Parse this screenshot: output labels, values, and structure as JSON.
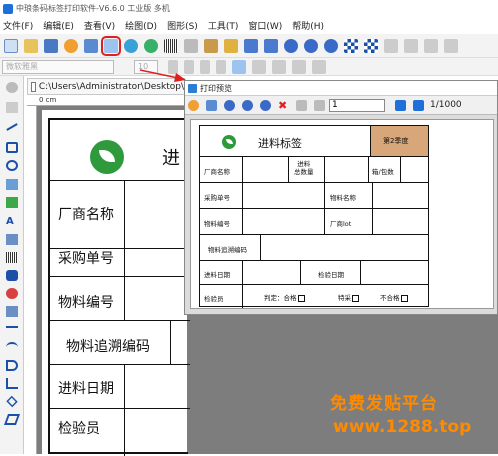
{
  "app": {
    "title": "中琅条码标签打印软件-V6.6.0 工业版 多机"
  },
  "menu": [
    "文件(F)",
    "编辑(E)",
    "查看(V)",
    "绘图(D)",
    "图形(S)",
    "工具(T)",
    "窗口(W)",
    "帮助(H)"
  ],
  "format_bar": {
    "font_placeholder": "微软雅黑",
    "size_placeholder": "10"
  },
  "doc_tab": {
    "path": "C:\\Users\\Administrator\\Desktop\\"
  },
  "ruler": {
    "origin": "0 cm"
  },
  "big_label": {
    "header_char": "进",
    "rows": [
      "厂商名称",
      "采购单号",
      "物料编号",
      "物料追溯编码",
      "进料日期",
      "检验员"
    ]
  },
  "preview": {
    "title": "打印预览",
    "page_value": "1",
    "page_count": "1/1000",
    "label": {
      "title": "进料标签",
      "season": "第2季度",
      "vendor": "厂商名称",
      "qty": "进料\n总数量",
      "box": "箱/包数",
      "po": "采购单号",
      "item_name": "物料名称",
      "item_no": "物料编号",
      "lot": "厂商lot",
      "trace": "物料追溯编码",
      "in_date": "进料日期",
      "check_date": "检验日期",
      "inspector": "检验员",
      "judge": "判定：合格",
      "special": "特采",
      "fail": "不合格"
    }
  },
  "watermark": {
    "line1": "免费发贴平台",
    "line2": "www.1288.top"
  },
  "colors": {
    "accent_red": "#e02020",
    "season_fill": "#d7a679",
    "leaf_green": "#2e9a3b",
    "watermark": "#ff8a00"
  }
}
